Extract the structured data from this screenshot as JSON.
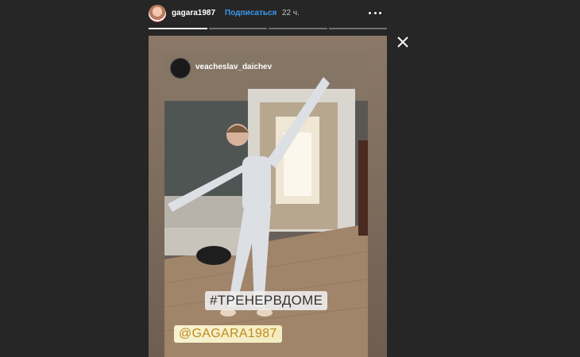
{
  "header": {
    "username": "gagara1987",
    "follow_label": "Подписаться",
    "time": "22 ч."
  },
  "progress": {
    "segments": 4,
    "current": 1
  },
  "story": {
    "reposted_from": "veacheslav_daichev",
    "hashtag_sticker": "#ТРЕНЕРВДОМЕ",
    "mention_sticker": "@GAGARA1987"
  },
  "icons": {
    "more": "more-options-icon",
    "close": "close-icon"
  }
}
